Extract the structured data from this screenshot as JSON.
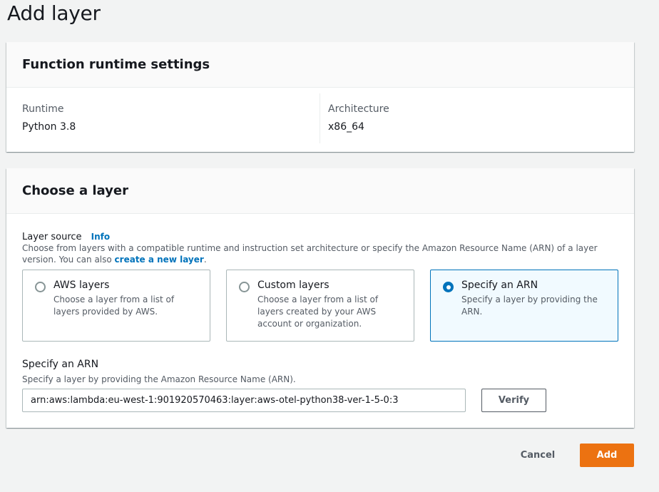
{
  "page": {
    "title": "Add layer"
  },
  "runtime_panel": {
    "title": "Function runtime settings",
    "runtime_label": "Runtime",
    "runtime_value": "Python 3.8",
    "architecture_label": "Architecture",
    "architecture_value": "x86_64"
  },
  "layer_panel": {
    "title": "Choose a layer",
    "source_label": "Layer source",
    "info_label": "Info",
    "source_desc_prefix": "Choose from layers with a compatible runtime and instruction set architecture or specify the Amazon Resource Name (ARN) of a layer version. You can also ",
    "source_desc_link": "create a new layer",
    "source_desc_suffix": ".",
    "options": [
      {
        "title": "AWS layers",
        "desc": "Choose a layer from a list of layers provided by AWS.",
        "selected": false
      },
      {
        "title": "Custom layers",
        "desc": "Choose a layer from a list of layers created by your AWS account or organization.",
        "selected": false
      },
      {
        "title": "Specify an ARN",
        "desc": "Specify a layer by providing the ARN.",
        "selected": true
      }
    ],
    "arn_label": "Specify an ARN",
    "arn_desc": "Specify a layer by providing the Amazon Resource Name (ARN).",
    "arn_value": "arn:aws:lambda:eu-west-1:901920570463:layer:aws-otel-python38-ver-1-5-0:3",
    "verify_label": "Verify"
  },
  "footer": {
    "cancel_label": "Cancel",
    "add_label": "Add"
  },
  "colors": {
    "accent": "#0073bb",
    "primary_button": "#ec7211",
    "background": "#f2f3f3"
  }
}
